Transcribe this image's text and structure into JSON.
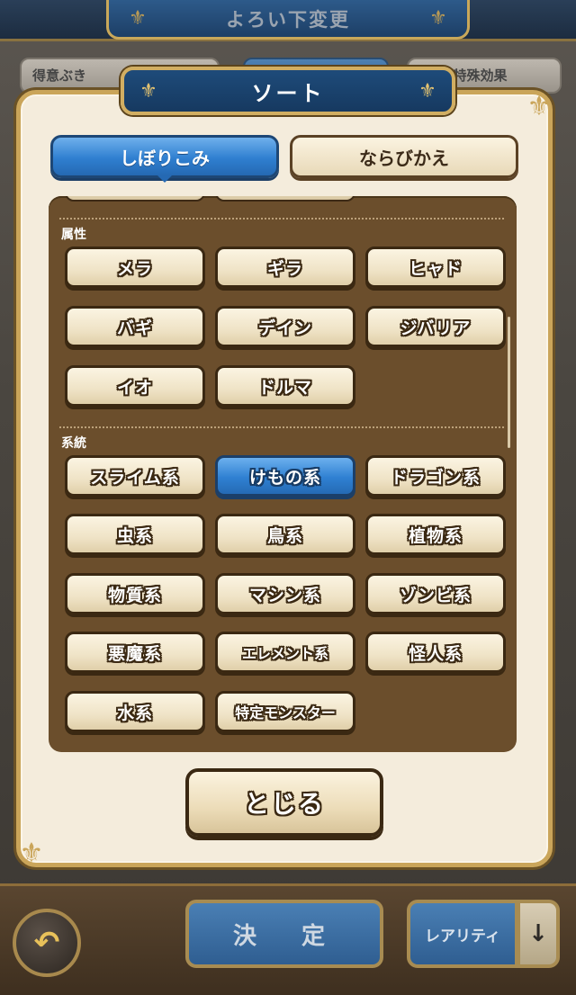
{
  "background": {
    "title": "よろい下変更",
    "tabs": [
      {
        "label": "得意ぶき"
      },
      {
        "label": ""
      },
      {
        "label": "キル･特殊効果"
      }
    ],
    "footer": {
      "back_icon": "undo-arrow-icon",
      "decide_label": "決　定",
      "rarity_label": "レアリティ",
      "rarity_arrow": "↓"
    }
  },
  "modal": {
    "title": "ソート",
    "segments": {
      "filter_label": "しぼりこみ",
      "sort_label": "ならびかえ",
      "active": "filter"
    },
    "sections": [
      {
        "label": "属性",
        "chips": [
          {
            "label": "メラ",
            "selected": false
          },
          {
            "label": "ギラ",
            "selected": false
          },
          {
            "label": "ヒャド",
            "selected": false
          },
          {
            "label": "バギ",
            "selected": false
          },
          {
            "label": "デイン",
            "selected": false
          },
          {
            "label": "ジバリア",
            "selected": false
          },
          {
            "label": "イオ",
            "selected": false
          },
          {
            "label": "ドルマ",
            "selected": false
          }
        ]
      },
      {
        "label": "系統",
        "chips": [
          {
            "label": "スライム系",
            "selected": false
          },
          {
            "label": "けもの系",
            "selected": true
          },
          {
            "label": "ドラゴン系",
            "selected": false
          },
          {
            "label": "虫系",
            "selected": false
          },
          {
            "label": "鳥系",
            "selected": false
          },
          {
            "label": "植物系",
            "selected": false
          },
          {
            "label": "物質系",
            "selected": false
          },
          {
            "label": "マシン系",
            "selected": false
          },
          {
            "label": "ゾンビ系",
            "selected": false
          },
          {
            "label": "悪魔系",
            "selected": false
          },
          {
            "label": "エレメント系",
            "selected": false
          },
          {
            "label": "怪人系",
            "selected": false
          },
          {
            "label": "水系",
            "selected": false
          },
          {
            "label": "特定モンスター",
            "selected": false
          }
        ]
      }
    ],
    "close_label": "とじる",
    "colors": {
      "selected_blue": "#2f80d2",
      "panel_brown": "#6b4e2c",
      "gold_frame": "#caa55a"
    }
  }
}
